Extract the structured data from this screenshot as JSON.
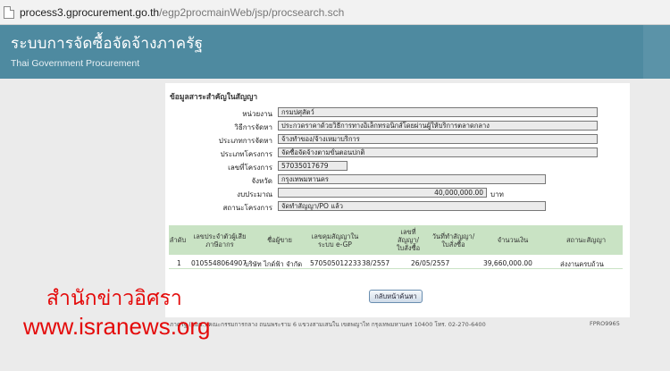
{
  "browser": {
    "url_host": "process3.gprocurement.go.th",
    "url_path": "/egp2procmainWeb/jsp/procsearch.sch"
  },
  "header": {
    "title_th": "ระบบการจัดซื้อจัดจ้างภาครัฐ",
    "title_en": "Thai Government Procurement"
  },
  "contract_info": {
    "section_title": "ข้อมูลสาระสำคัญในสัญญา",
    "fields": [
      {
        "label": "หน่วยงาน",
        "value": "กรมปศุสัตว์"
      },
      {
        "label": "วิธีการจัดหา",
        "value": "ประกวดราคาด้วยวิธีการทางอิเล็กทรอนิกส์โดยผ่านผู้ให้บริการตลาดกลาง"
      },
      {
        "label": "ประเภทการจัดหา",
        "value": "จ้างทำของ/จ้างเหมาบริการ"
      },
      {
        "label": "ประเภทโครงการ",
        "value": "จัดซื้อจัดจ้างตามขั้นตอนปกติ"
      },
      {
        "label": "เลขที่โครงการ",
        "value": "57035017679"
      },
      {
        "label": "จังหวัด",
        "value": "กรุงเทพมหานคร"
      },
      {
        "label": "งบประมาณ",
        "value": "40,000,000.00",
        "unit": "บาท"
      },
      {
        "label": "สถานะโครงการ",
        "value": "จัดทำสัญญา/PO แล้ว"
      }
    ]
  },
  "table": {
    "headers": {
      "no": "ลำดับ",
      "taxid": "เลขประจำตัวผู้เสียภาษีอากร",
      "seller": "ชื่อผู้ขาย",
      "egp_no": "เลขคุมสัญญาในระบบ e-GP",
      "contract_no": "เลขที่สัญญา/ใบสั่งซื้อ",
      "contract_date": "วันที่ทำสัญญา/ใบสั่งซื้อ",
      "amount": "จำนวนเงิน",
      "status": "สถานะสัญญา"
    },
    "rows": [
      {
        "no": "1",
        "taxid": "0105548064907",
        "seller": "บริษัท ไกด์ฟ้า จำกัด",
        "egp_no": "570505012233",
        "contract_no": "38/2557",
        "contract_date": "26/05/2557",
        "amount": "39,660,000.00",
        "status": "ส่งงานครบถ้วน"
      }
    ]
  },
  "back_button": "กลับหน้าค้นหา",
  "footer": {
    "text": "ภาครัฐ (สมช.) คณะกรรมการกลาง ถนนพระราม 6 แขวงสามเสนใน เขตพญาไท กรุงเทพมหานคร 10400 โทร. 02-270-6400",
    "code": "FPRO9965"
  },
  "watermark": {
    "line1": "สำนักข่าวอิศรา",
    "line2": "www.isranews.org"
  },
  "colors": {
    "banner": "#4e8aa0",
    "table_header": "#c9e3c4",
    "watermark": "#e40a0a"
  }
}
